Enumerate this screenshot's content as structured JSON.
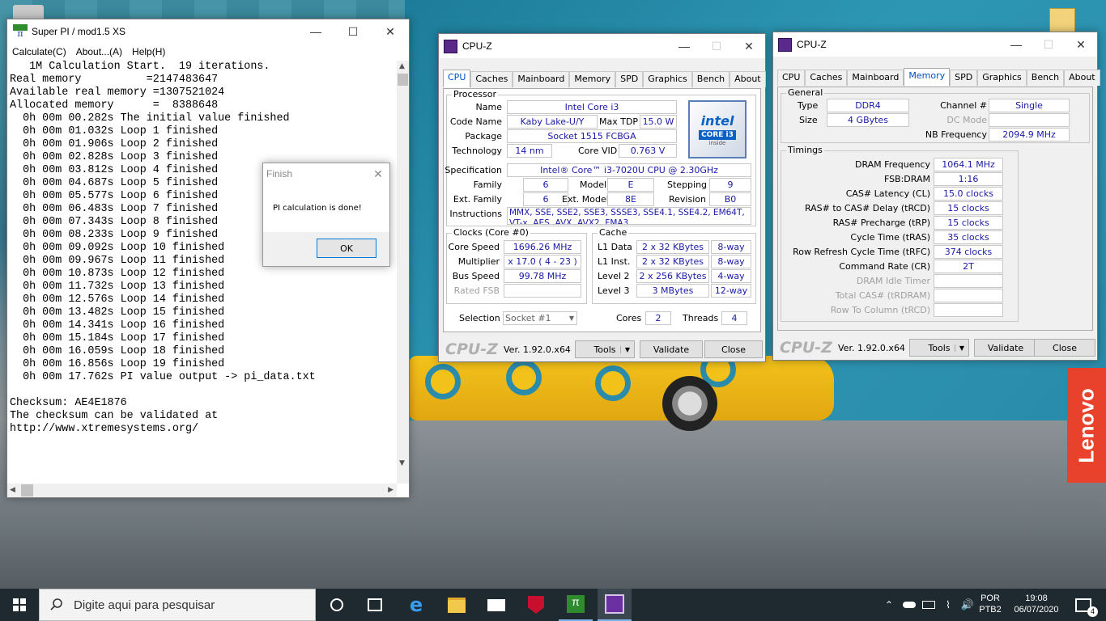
{
  "superpi": {
    "title": "Super PI / mod1.5 XS",
    "menu": [
      "Calculate(C)",
      "About...(A)",
      "Help(H)"
    ],
    "output": "   1M Calculation Start.  19 iterations.\nReal memory          =2147483647\nAvailable real memory =1307521024\nAllocated memory      =  8388648\n  0h 00m 00.282s The initial value finished\n  0h 00m 01.032s Loop 1 finished\n  0h 00m 01.906s Loop 2 finished\n  0h 00m 02.828s Loop 3 finished\n  0h 00m 03.812s Loop 4 finished\n  0h 00m 04.687s Loop 5 finished\n  0h 00m 05.577s Loop 6 finished\n  0h 00m 06.483s Loop 7 finished\n  0h 00m 07.343s Loop 8 finished\n  0h 00m 08.233s Loop 9 finished\n  0h 00m 09.092s Loop 10 finished\n  0h 00m 09.967s Loop 11 finished\n  0h 00m 10.873s Loop 12 finished\n  0h 00m 11.732s Loop 13 finished\n  0h 00m 12.576s Loop 14 finished\n  0h 00m 13.482s Loop 15 finished\n  0h 00m 14.341s Loop 16 finished\n  0h 00m 15.184s Loop 17 finished\n  0h 00m 16.059s Loop 18 finished\n  0h 00m 16.856s Loop 19 finished\n  0h 00m 17.762s PI value output -> pi_data.txt\n\nChecksum: AE4E1876\nThe checksum can be validated at\nhttp://www.xtremesystems.org/"
  },
  "finish_dialog": {
    "title": "Finish",
    "message": "PI calculation is done!",
    "ok_label": "OK"
  },
  "cpuz1": {
    "title": "CPU-Z",
    "tabs": [
      "CPU",
      "Caches",
      "Mainboard",
      "Memory",
      "SPD",
      "Graphics",
      "Bench",
      "About"
    ],
    "processor_group": "Processor",
    "labels": {
      "name": "Name",
      "code_name": "Code Name",
      "max_tdp": "Max TDP",
      "package": "Package",
      "technology": "Technology",
      "core_vid": "Core VID",
      "specification": "Specification",
      "family": "Family",
      "model": "Model",
      "stepping": "Stepping",
      "ext_family": "Ext. Family",
      "ext_model": "Ext. Model",
      "revision": "Revision",
      "instructions": "Instructions"
    },
    "values": {
      "name": "Intel Core i3",
      "code_name": "Kaby Lake-U/Y",
      "max_tdp": "15.0 W",
      "package": "Socket 1515 FCBGA",
      "technology": "14 nm",
      "core_vid": "0.763 V",
      "specification": "Intel® Core™ i3-7020U CPU @ 2.30GHz",
      "family": "6",
      "model": "E",
      "stepping": "9",
      "ext_family": "6",
      "ext_model": "8E",
      "revision": "B0",
      "instructions": "MMX, SSE, SSE2, SSE3, SSSE3, SSE4.1, SSE4.2, EM64T, VT-x, AES, AVX, AVX2, FMA3"
    },
    "intel_logo": {
      "brand": "intel",
      "line": "CORE i3",
      "sub": "inside"
    },
    "clocks_group": "Clocks (Core #0)",
    "clocks": {
      "core_speed_label": "Core Speed",
      "core_speed": "1696.26 MHz",
      "multiplier_label": "Multiplier",
      "multiplier": "x 17.0 ( 4 - 23 )",
      "bus_speed_label": "Bus Speed",
      "bus_speed": "99.78 MHz",
      "rated_fsb_label": "Rated FSB",
      "rated_fsb": ""
    },
    "cache_group": "Cache",
    "cache": {
      "l1d_label": "L1 Data",
      "l1d": "2 x 32 KBytes",
      "l1d_way": "8-way",
      "l1i_label": "L1 Inst.",
      "l1i": "2 x 32 KBytes",
      "l1i_way": "8-way",
      "l2_label": "Level 2",
      "l2": "2 x 256 KBytes",
      "l2_way": "4-way",
      "l3_label": "Level 3",
      "l3": "3 MBytes",
      "l3_way": "12-way"
    },
    "selection_label": "Selection",
    "selection_value": "Socket #1",
    "cores_label": "Cores",
    "cores": "2",
    "threads_label": "Threads",
    "threads": "4",
    "brand": "CPU-Z",
    "version": "Ver. 1.92.0.x64",
    "tools_label": "Tools",
    "validate_label": "Validate",
    "close_label": "Close"
  },
  "cpuz2": {
    "title": "CPU-Z",
    "tabs": [
      "CPU",
      "Caches",
      "Mainboard",
      "Memory",
      "SPD",
      "Graphics",
      "Bench",
      "About"
    ],
    "general_group": "General",
    "general": {
      "type_label": "Type",
      "type": "DDR4",
      "size_label": "Size",
      "size": "4 GBytes",
      "channel_label": "Channel #",
      "channel": "Single",
      "dc_mode_label": "DC Mode",
      "dc_mode": "",
      "nb_freq_label": "NB Frequency",
      "nb_freq": "2094.9 MHz"
    },
    "timings_group": "Timings",
    "timings": [
      {
        "label": "DRAM Frequency",
        "value": "1064.1 MHz",
        "disabled": false
      },
      {
        "label": "FSB:DRAM",
        "value": "1:16",
        "disabled": false
      },
      {
        "label": "CAS# Latency (CL)",
        "value": "15.0 clocks",
        "disabled": false
      },
      {
        "label": "RAS# to CAS# Delay (tRCD)",
        "value": "15 clocks",
        "disabled": false
      },
      {
        "label": "RAS# Precharge (tRP)",
        "value": "15 clocks",
        "disabled": false
      },
      {
        "label": "Cycle Time (tRAS)",
        "value": "35 clocks",
        "disabled": false
      },
      {
        "label": "Row Refresh Cycle Time (tRFC)",
        "value": "374 clocks",
        "disabled": false
      },
      {
        "label": "Command Rate (CR)",
        "value": "2T",
        "disabled": false
      },
      {
        "label": "DRAM Idle Timer",
        "value": "",
        "disabled": true
      },
      {
        "label": "Total CAS# (tRDRAM)",
        "value": "",
        "disabled": true
      },
      {
        "label": "Row To Column (tRCD)",
        "value": "",
        "disabled": true
      }
    ],
    "brand": "CPU-Z",
    "version": "Ver. 1.92.0.x64",
    "tools_label": "Tools",
    "validate_label": "Validate",
    "close_label": "Close"
  },
  "desktop": {
    "lenovo_text": "Lenovo"
  },
  "taskbar": {
    "search_placeholder": "Digite aqui para pesquisar",
    "lang_top": "POR",
    "lang_bottom": "PTB2",
    "time": "19:08",
    "date": "06/07/2020",
    "notification_count": "4",
    "icons": [
      "start-icon",
      "search-icon",
      "cortana-icon",
      "task-view-icon",
      "edge-icon",
      "file-explorer-icon",
      "mail-icon",
      "mcafee-icon",
      "superpi-icon",
      "cpuz-icon"
    ]
  },
  "colors": {
    "value_text": "#1a1aa6",
    "active_tab": "#0050c0",
    "taskbar": "#1f2a30",
    "lenovo": "#e8412c"
  }
}
